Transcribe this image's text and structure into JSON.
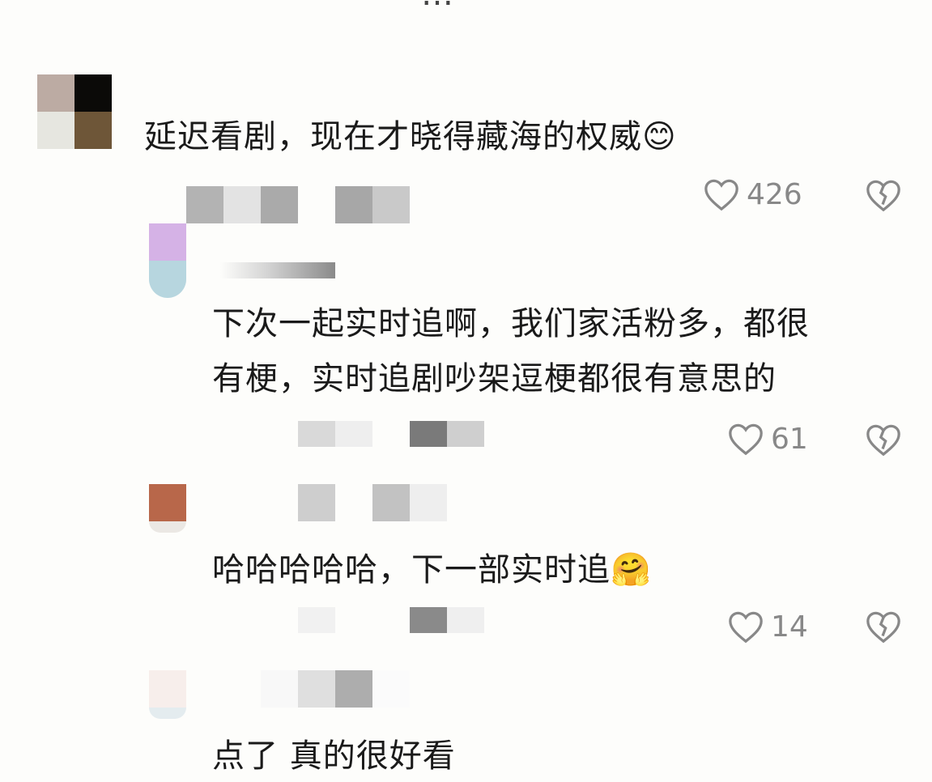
{
  "header": {
    "title_partial": "…"
  },
  "comments": [
    {
      "text": "延迟看剧，现在才晓得藏海的权威",
      "emoji": "😊",
      "likes": "426"
    },
    {
      "text_line1": "下次一起实时追啊，我们家活粉多，都很",
      "text_line2": "有梗，实时追剧吵架逗梗都很有意思的",
      "likes": "61"
    },
    {
      "text": "哈哈哈哈哈，下一部实时追",
      "emoji": "🤗",
      "likes": "14"
    },
    {
      "text": "点了 真的很好看"
    }
  ],
  "icons": {
    "like": "heart-outline-icon",
    "dislike": "broken-heart-icon"
  },
  "colors": {
    "like_gray": "#888888",
    "text": "#1a1a1a",
    "background": "#fdfdfb"
  }
}
